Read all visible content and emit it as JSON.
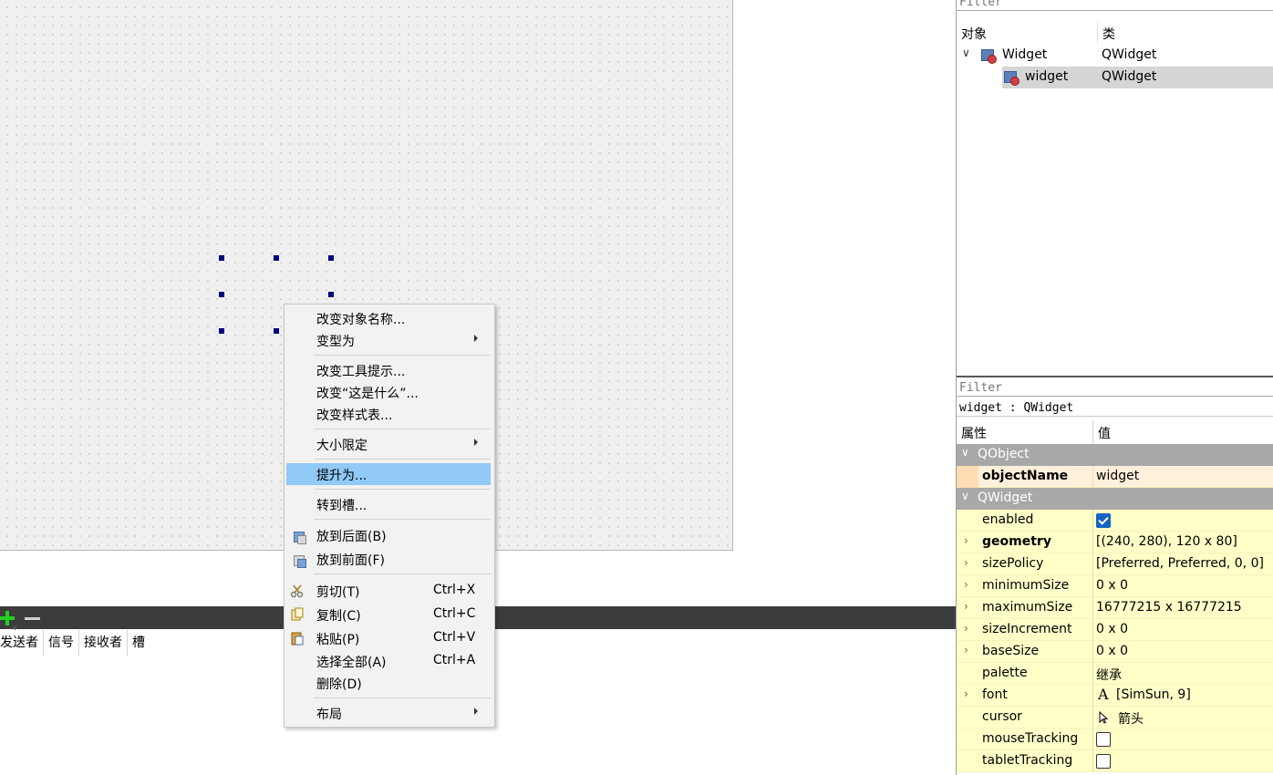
{
  "colors": {
    "menu_highlight": "#91c9f7",
    "selection_handle": "#000080",
    "property_group_bg": "#a8a8a8",
    "property_row_bg": "#ffffc8",
    "object_row_bg": "#fff0dc",
    "checkbox_on": "#1565c0"
  },
  "context_menu": {
    "items": [
      {
        "label": "改变对象名称..."
      },
      {
        "label": "变型为",
        "submenu": true
      },
      {
        "label": "改变工具提示..."
      },
      {
        "label": "改变“这是什么”..."
      },
      {
        "label": "改变样式表..."
      },
      {
        "label": "大小限定",
        "submenu": true
      },
      {
        "label": "提升为...",
        "highlighted": true
      },
      {
        "label": "转到槽..."
      },
      {
        "label": "放到后面(B)",
        "icon": "send-to-back-icon"
      },
      {
        "label": "放到前面(F)",
        "icon": "bring-to-front-icon"
      },
      {
        "label": "剪切(T)",
        "shortcut": "Ctrl+X",
        "icon": "scissors-icon"
      },
      {
        "label": "复制(C)",
        "shortcut": "Ctrl+C",
        "icon": "copy-icon"
      },
      {
        "label": "粘贴(P)",
        "shortcut": "Ctrl+V",
        "icon": "paste-icon"
      },
      {
        "label": "选择全部(A)",
        "shortcut": "Ctrl+A"
      },
      {
        "label": "删除(D)"
      },
      {
        "label": "布局",
        "submenu": true
      }
    ]
  },
  "signal_slot_editor": {
    "add_icon": "plus-icon",
    "remove_icon": "minus-icon",
    "columns": [
      "发送者",
      "信号",
      "接收者",
      "槽"
    ]
  },
  "object_inspector": {
    "filter_placeholder": "Filter",
    "columns": [
      "对象",
      "类"
    ],
    "rows": [
      {
        "name": "Widget",
        "class": "QWidget",
        "expanded": true
      },
      {
        "name": "widget",
        "class": "QWidget",
        "selected": true
      }
    ]
  },
  "property_editor": {
    "filter_placeholder": "Filter",
    "caption": "widget : QWidget",
    "columns": [
      "属性",
      "值"
    ],
    "groups": [
      {
        "name": "QObject",
        "properties": [
          {
            "name": "objectName",
            "value": "widget",
            "bold": true
          }
        ]
      },
      {
        "name": "QWidget",
        "properties": [
          {
            "name": "enabled",
            "checked": true
          },
          {
            "name": "geometry",
            "value": "[(240, 280), 120 x 80]",
            "bold": true
          },
          {
            "name": "sizePolicy",
            "value": "[Preferred, Preferred, 0, 0]"
          },
          {
            "name": "minimumSize",
            "value": "0 x 0"
          },
          {
            "name": "maximumSize",
            "value": "16777215 x 16777215"
          },
          {
            "name": "sizeIncrement",
            "value": "0 x 0"
          },
          {
            "name": "baseSize",
            "value": "0 x 0"
          },
          {
            "name": "palette",
            "value": "继承"
          },
          {
            "name": "font",
            "value": "[SimSun, 9]",
            "icon_glyph": "A"
          },
          {
            "name": "cursor",
            "value": "箭头"
          },
          {
            "name": "mouseTracking",
            "checked": false
          },
          {
            "name": "tabletTracking",
            "checked": false
          }
        ]
      }
    ]
  }
}
